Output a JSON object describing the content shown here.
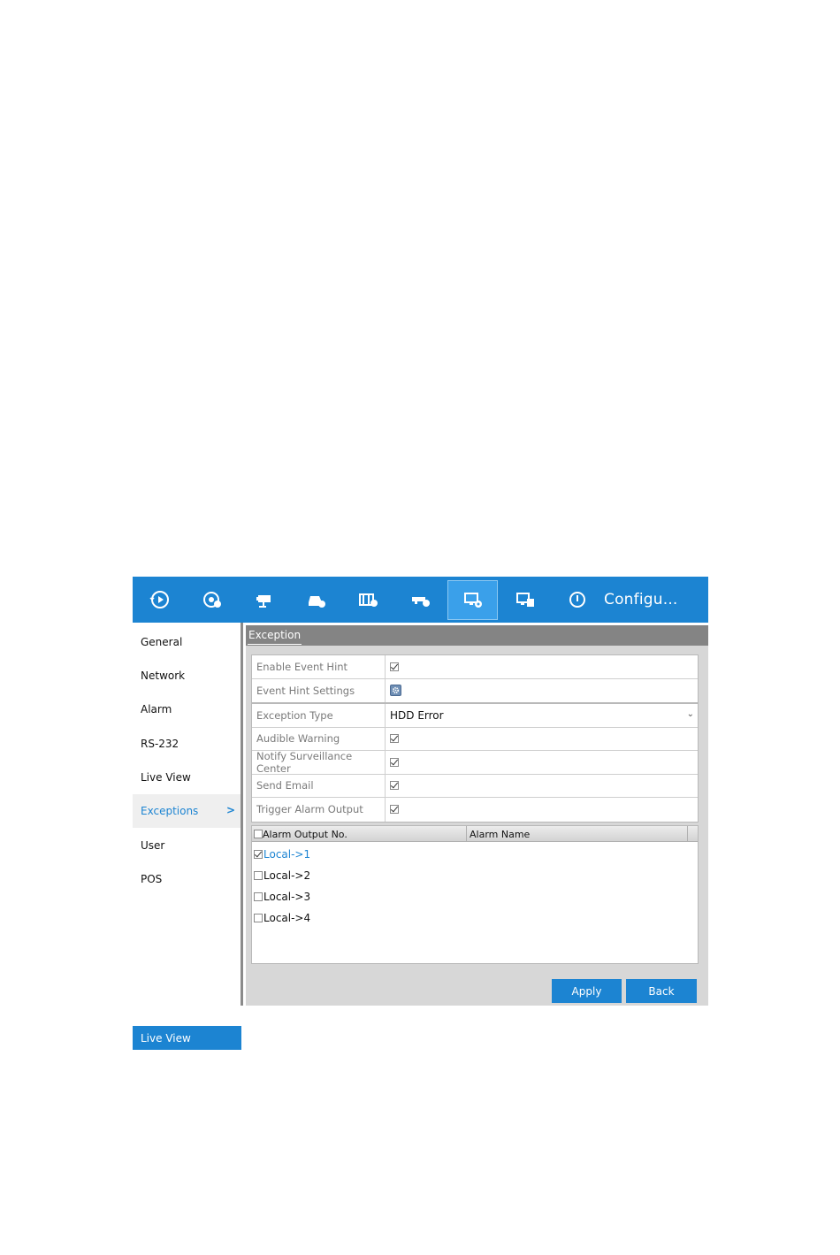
{
  "toolbar": {
    "title": "Configu...",
    "icons": [
      "playback-icon",
      "record-icon",
      "camera-icon",
      "hdd-icon",
      "video-settings-icon",
      "network-camera-icon",
      "configuration-icon",
      "maintenance-icon",
      "shutdown-icon"
    ],
    "accent": "#1c84d2"
  },
  "sidebar": {
    "items": [
      {
        "label": "General"
      },
      {
        "label": "Network"
      },
      {
        "label": "Alarm"
      },
      {
        "label": "RS-232"
      },
      {
        "label": "Live View"
      },
      {
        "label": "Exceptions",
        "chevron": ">"
      },
      {
        "label": "User"
      },
      {
        "label": "POS"
      }
    ],
    "bottom_label": "Live View"
  },
  "panel": {
    "tab": "Exception",
    "hint": {
      "enable_event_hint_label": "Enable Event Hint",
      "enable_event_hint_checked": true,
      "event_hint_settings_label": "Event Hint Settings"
    },
    "exception": {
      "type_label": "Exception Type",
      "type_value": "HDD Error",
      "audible_warning_label": "Audible Warning",
      "audible_warning_checked": true,
      "notify_center_label": "Notify Surveillance Center",
      "notify_center_checked": true,
      "send_email_label": "Send Email",
      "send_email_checked": true,
      "trigger_alarm_label": "Trigger Alarm Output",
      "trigger_alarm_checked": true
    },
    "table": {
      "headers": [
        "Alarm Output No.",
        "Alarm Name"
      ],
      "rows": [
        {
          "no": "Local->1",
          "checked": true
        },
        {
          "no": "Local->2",
          "checked": false
        },
        {
          "no": "Local->3",
          "checked": false
        },
        {
          "no": "Local->4",
          "checked": false
        }
      ]
    },
    "apply_label": "Apply",
    "back_label": "Back"
  }
}
